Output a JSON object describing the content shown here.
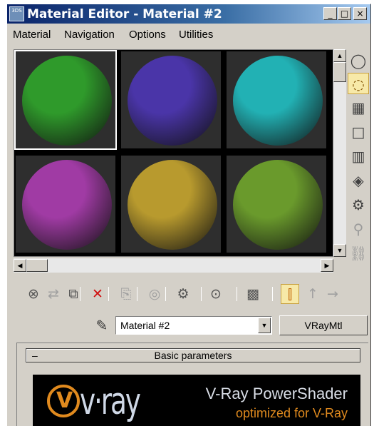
{
  "window": {
    "title": "Material Editor - Material #2",
    "app_icon_text": "3DS",
    "controls": {
      "minimize": "_",
      "maximize": "□",
      "close": "×"
    }
  },
  "menu": {
    "items": [
      "Material",
      "Navigation",
      "Options",
      "Utilities"
    ]
  },
  "sample_slots": {
    "selected_index": 0,
    "slots": [
      {
        "color": "#2f9a2b"
      },
      {
        "color": "#4a35a8"
      },
      {
        "color": "#22b1b4"
      },
      {
        "color": "#a03ba4"
      },
      {
        "color": "#b89a2e"
      },
      {
        "color": "#6a9a2c"
      }
    ]
  },
  "scrollbars": {
    "up_arrow": "▲",
    "down_arrow": "▼",
    "left_arrow": "◀",
    "right_arrow": "▶"
  },
  "side_tools": [
    {
      "icon": "sample-type-sphere-icon",
      "glyph": "◯",
      "state": "normal"
    },
    {
      "icon": "backlight-icon",
      "glyph": "◌",
      "state": "active"
    },
    {
      "icon": "background-checker-icon",
      "glyph": "▦",
      "state": "normal"
    },
    {
      "icon": "sample-uv-tiling-icon",
      "glyph": "□",
      "state": "normal"
    },
    {
      "icon": "video-color-check-icon",
      "glyph": "▥",
      "state": "normal"
    },
    {
      "icon": "make-preview-icon",
      "glyph": "◈",
      "state": "normal"
    },
    {
      "icon": "options-icon",
      "glyph": "⚙",
      "state": "normal"
    },
    {
      "icon": "select-by-material-icon",
      "glyph": "⚲",
      "state": "dim"
    },
    {
      "icon": "material-map-navigator-icon",
      "glyph": "⛓",
      "state": "dim"
    }
  ],
  "toolbar": [
    {
      "icon": "get-material-icon",
      "glyph": "⊗",
      "state": "normal"
    },
    {
      "icon": "put-material-to-scene-icon",
      "glyph": "⇄",
      "state": "dim"
    },
    {
      "icon": "assign-material-icon",
      "glyph": "⧉",
      "state": "normal"
    },
    {
      "icon": "reset-map-icon",
      "glyph": "✕",
      "state": "red"
    },
    {
      "icon": "make-material-copy-icon",
      "glyph": "⎘",
      "state": "dim"
    },
    {
      "icon": "make-unique-icon",
      "glyph": "◎",
      "state": "dim"
    },
    {
      "icon": "put-to-library-icon",
      "glyph": "⚙",
      "state": "normal"
    },
    {
      "icon": "material-effects-channel-icon",
      "glyph": "⊙",
      "state": "normal"
    },
    {
      "icon": "show-map-in-viewport-icon",
      "glyph": "▩",
      "state": "normal"
    },
    {
      "icon": "show-end-result-icon",
      "glyph": "⫿",
      "state": "active"
    },
    {
      "icon": "go-to-parent-icon",
      "glyph": "↑",
      "state": "dim"
    },
    {
      "icon": "go-forward-to-sibling-icon",
      "glyph": "→",
      "state": "dim"
    }
  ],
  "material": {
    "name": "Material #2",
    "type": "VRayMtl"
  },
  "rollout": {
    "toggle": "–",
    "title": "Basic parameters"
  },
  "banner": {
    "logo_symbol": "V",
    "wordmark": "v·ray",
    "line1": "V-Ray PowerShader",
    "line2": "optimized for V-Ray",
    "accent": "#e08a1e"
  }
}
